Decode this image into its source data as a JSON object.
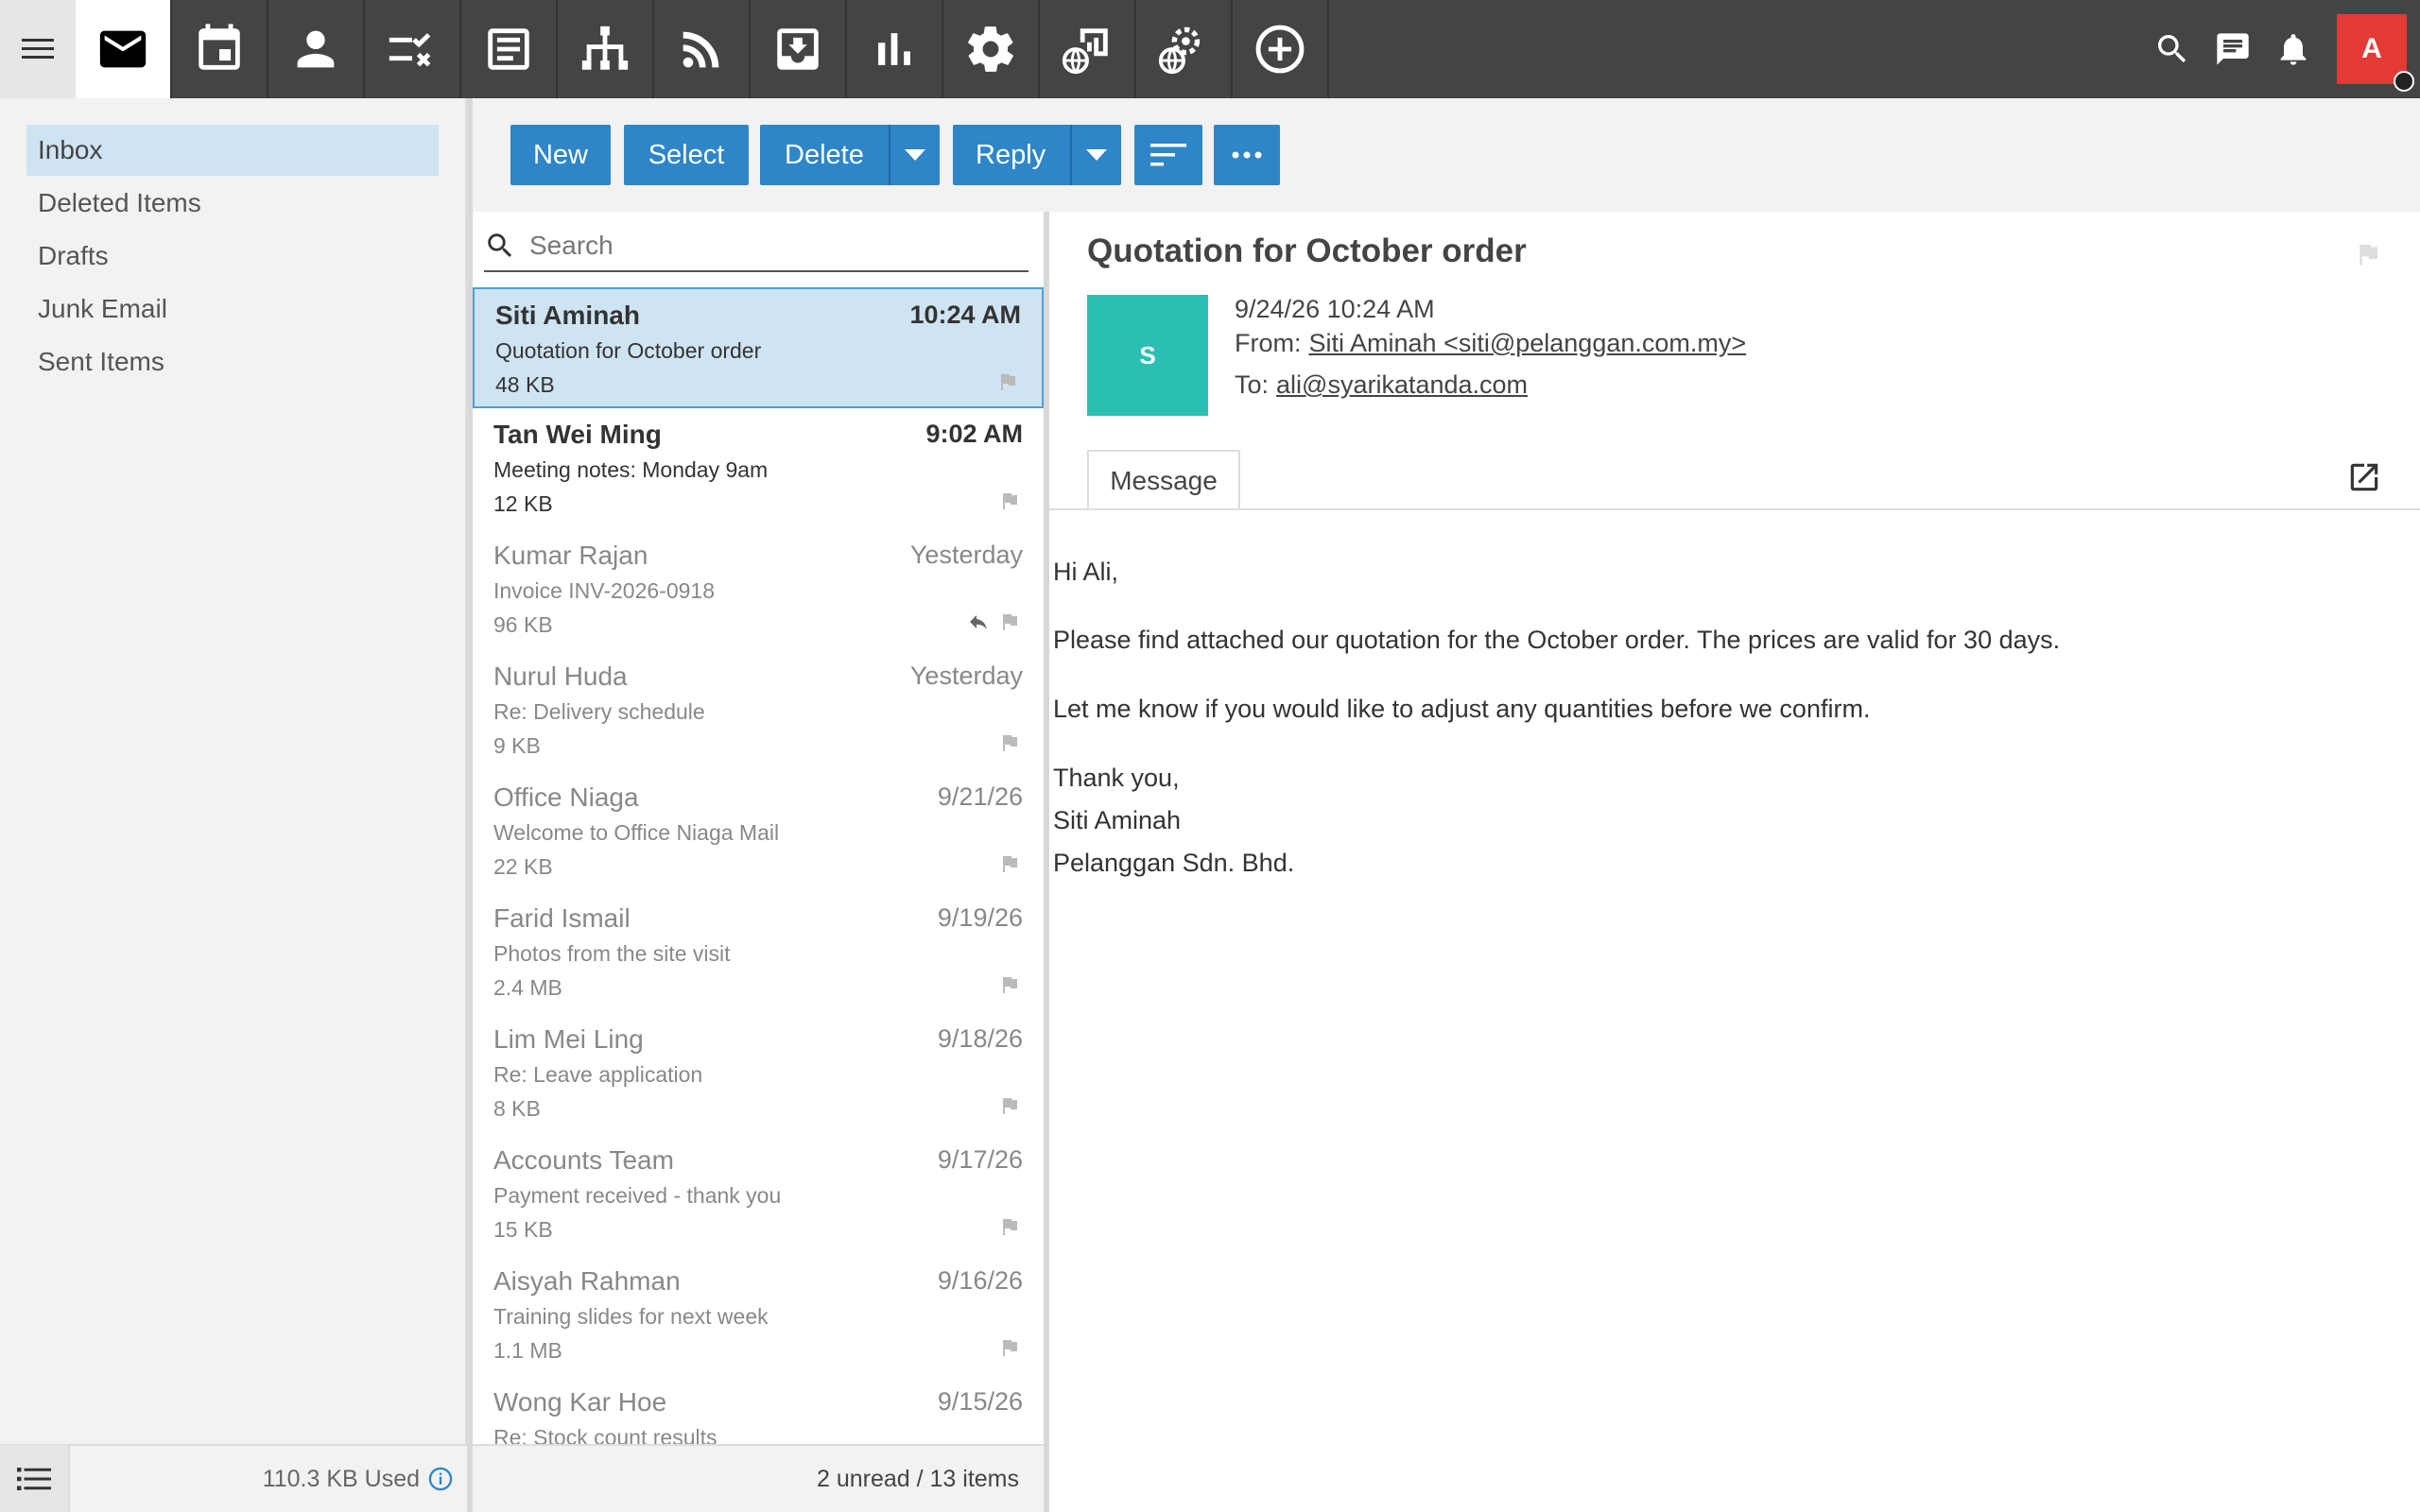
{
  "topbar": {
    "apps": [
      {
        "name": "mail",
        "active": true
      },
      {
        "name": "calendar",
        "active": false
      },
      {
        "name": "contacts",
        "active": false
      },
      {
        "name": "tasks",
        "active": false
      },
      {
        "name": "notes",
        "active": false
      },
      {
        "name": "org-chart",
        "active": false
      },
      {
        "name": "rss",
        "active": false
      },
      {
        "name": "download",
        "active": false
      },
      {
        "name": "reports",
        "active": false
      },
      {
        "name": "settings",
        "active": false
      },
      {
        "name": "web-analytics",
        "active": false
      },
      {
        "name": "web-settings",
        "active": false
      },
      {
        "name": "add",
        "active": false
      }
    ],
    "user_initial": "A"
  },
  "sidebar": {
    "folders": [
      {
        "label": "Inbox",
        "active": true
      },
      {
        "label": "Deleted Items",
        "active": false
      },
      {
        "label": "Drafts",
        "active": false
      },
      {
        "label": "Junk Email",
        "active": false
      },
      {
        "label": "Sent Items",
        "active": false
      }
    ],
    "quota": "110.3 KB Used"
  },
  "toolbar": {
    "new_label": "New",
    "select_label": "Select",
    "delete_label": "Delete",
    "reply_label": "Reply"
  },
  "search": {
    "placeholder": "Search"
  },
  "messages": [
    {
      "from": "Siti Aminah",
      "time": "10:24 AM",
      "subject": "Quotation for October order",
      "size": "48 KB",
      "unread": true,
      "selected": true,
      "replied": false
    },
    {
      "from": "Tan Wei Ming",
      "time": "9:02 AM",
      "subject": "Meeting notes: Monday 9am",
      "size": "12 KB",
      "unread": true,
      "selected": false,
      "replied": false
    },
    {
      "from": "Kumar Rajan",
      "time": "Yesterday",
      "subject": "Invoice INV-2026-0918",
      "size": "96 KB",
      "unread": false,
      "selected": false,
      "replied": true
    },
    {
      "from": "Nurul Huda",
      "time": "Yesterday",
      "subject": "Re: Delivery schedule",
      "size": "9 KB",
      "unread": false,
      "selected": false,
      "replied": false
    },
    {
      "from": "Office Niaga",
      "time": "9/21/26",
      "subject": "Welcome to Office Niaga Mail",
      "size": "22 KB",
      "unread": false,
      "selected": false,
      "replied": false
    },
    {
      "from": "Farid Ismail",
      "time": "9/19/26",
      "subject": "Photos from the site visit",
      "size": "2.4 MB",
      "unread": false,
      "selected": false,
      "replied": false
    },
    {
      "from": "Lim Mei Ling",
      "time": "9/18/26",
      "subject": "Re: Leave application",
      "size": "8 KB",
      "unread": false,
      "selected": false,
      "replied": false
    },
    {
      "from": "Accounts Team",
      "time": "9/17/26",
      "subject": "Payment received - thank you",
      "size": "15 KB",
      "unread": false,
      "selected": false,
      "replied": false
    },
    {
      "from": "Aisyah Rahman",
      "time": "9/16/26",
      "subject": "Training slides for next week",
      "size": "1.1 MB",
      "unread": false,
      "selected": false,
      "replied": false
    },
    {
      "from": "Wong Kar Hoe",
      "time": "9/15/26",
      "subject": "Re: Stock count results",
      "size": "",
      "unread": false,
      "selected": false,
      "replied": false
    }
  ],
  "list_status": "2 unread / 13 items",
  "reading": {
    "subject": "Quotation for October order",
    "sender_initial": "S",
    "date": "9/24/26 10:24 AM",
    "from_label": "From:",
    "from_value": "Siti Aminah <siti@pelanggan.com.my>",
    "to_label": "To:",
    "to_value": "ali@syarikatanda.com",
    "tab_label": "Message",
    "body": {
      "greeting": "Hi Ali,",
      "p1": "Please find attached our quotation for the October order. The prices are valid for 30 days.",
      "p2": "Let me know if you would like to adjust any quantities before we confirm.",
      "closing": "Thank you,",
      "sig_name": "Siti Aminah",
      "sig_company": "Pelanggan Sdn. Bhd."
    }
  },
  "colors": {
    "topbar": "#444444",
    "accent": "#2e86c8",
    "selection": "#cfe4f3",
    "sender_avatar": "#2bbfb3",
    "user_avatar": "#e53935"
  }
}
